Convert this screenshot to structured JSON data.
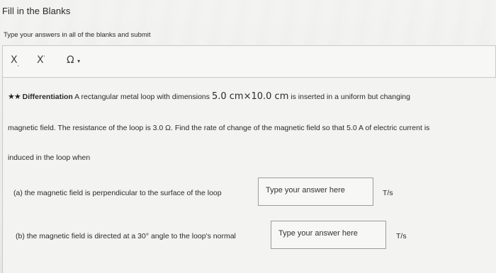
{
  "header": {
    "title": "Fill in the Blanks",
    "instructions": "Type your answers in all of the blanks and submit"
  },
  "toolbar": {
    "subscript_label": "X",
    "subscript_mark": ",",
    "superscript_label": "X",
    "superscript_mark": "'",
    "symbol_label": "Ω",
    "symbol_caret": "▾"
  },
  "question": {
    "stars": "★★",
    "lead": "Differentiation",
    "text_1": " A rectangular metal loop with dimensions ",
    "dimension_1": "5.0 cm",
    "times": "×",
    "dimension_2": "10.0 cm",
    "text_2": " is inserted in a uniform but changing",
    "line_2": "magnetic field. The resistance of the loop is 3.0 Ω. Find the rate of change of the magnetic field so that 5.0 A of electric current is",
    "line_3": "induced in the loop when"
  },
  "parts": [
    {
      "label": "(a) the magnetic field is perpendicular to the surface of the loop",
      "placeholder": "Type your answer here",
      "unit": "T/s"
    },
    {
      "label": "(b) the magnetic field is directed at a 30° angle to the loop's normal",
      "placeholder": "Type your answer here",
      "unit": "T/s"
    }
  ]
}
